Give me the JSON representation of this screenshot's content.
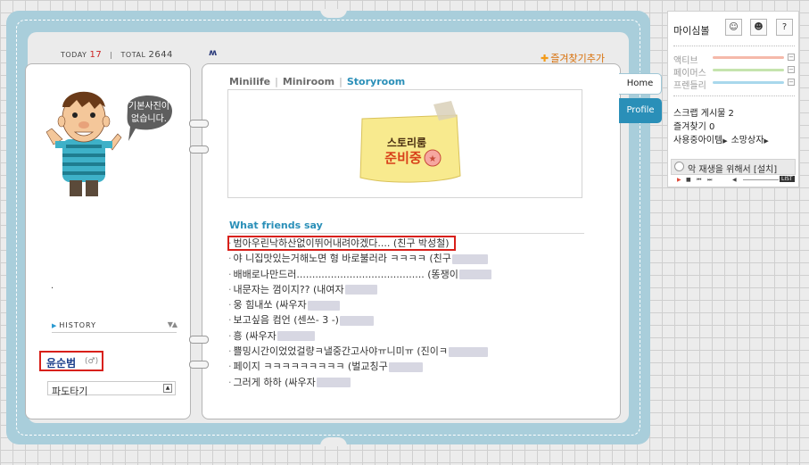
{
  "counter": {
    "today_label": "TODAY",
    "today_value": "17",
    "total_label": "TOTAL",
    "total_value": "2644"
  },
  "header": {
    "logo": "ʍ",
    "add_favorite": "즐겨찾기추가"
  },
  "avatar": {
    "speech_line1": "기본사진이",
    "speech_line2": "없습니다."
  },
  "left": {
    "dot": ".",
    "history": "HISTORY",
    "owner_name": "윤순범",
    "owner_gender": "(♂)",
    "wave_select": "파도타기"
  },
  "tabs": [
    {
      "label": "Minilife"
    },
    {
      "label": "Miniroom"
    },
    {
      "label": "Storyroom"
    }
  ],
  "storybox": {
    "sign_line1": "스토리룸",
    "sign_line2": "준비중"
  },
  "friends": {
    "title": "What friends say",
    "items": [
      {
        "text": "범아우린낙하산없이뛰어내려야겠다.... (친구 박성철)",
        "blur": 0
      },
      {
        "text": "야 니집맛있는거해노면 형 바로불러라 ㅋㅋㅋㅋ (친구",
        "blur": 40
      },
      {
        "text": "배배로나만드러......................................... (똥쟁이",
        "blur": 36
      },
      {
        "text": "내문자는 껌이지?? (내여자",
        "blur": 36
      },
      {
        "text": "웅 힘내쏘 (싸우자",
        "blur": 36
      },
      {
        "text": "보고싶음 컴언 (센쓰- 3 -)",
        "blur": 38
      },
      {
        "text": "흥 (싸우자",
        "blur": 42
      },
      {
        "text": "쁠밍시간이었었걸량ㅋ낼중간고사야ㅠ니미ㅠ (진이ㅋ",
        "blur": 44
      },
      {
        "text": "페이지 ㅋㅋㅋㅋㅋㅋㅋㅋㅋ (벌교칭구",
        "blur": 38
      },
      {
        "text": "그러게 하하 (싸우자",
        "blur": 38
      }
    ]
  },
  "side_tabs": {
    "home": "Home",
    "profile": "Profile"
  },
  "side": {
    "title": "마이심볼",
    "help": "?",
    "meters": [
      {
        "label": "액티브",
        "color": "#f5b9aa"
      },
      {
        "label": "페이머스",
        "color": "#c5e4ad"
      },
      {
        "label": "프렌들리",
        "color": "#a9d8ec"
      }
    ],
    "minus": "−",
    "scrap": "스크랩 게시물 2",
    "favorite": "즐겨찾기 0",
    "items": "사용중아이템",
    "wishlist": "소망상자",
    "bgm": "악 재생을 위해서 [설치]",
    "list": "LIST"
  }
}
